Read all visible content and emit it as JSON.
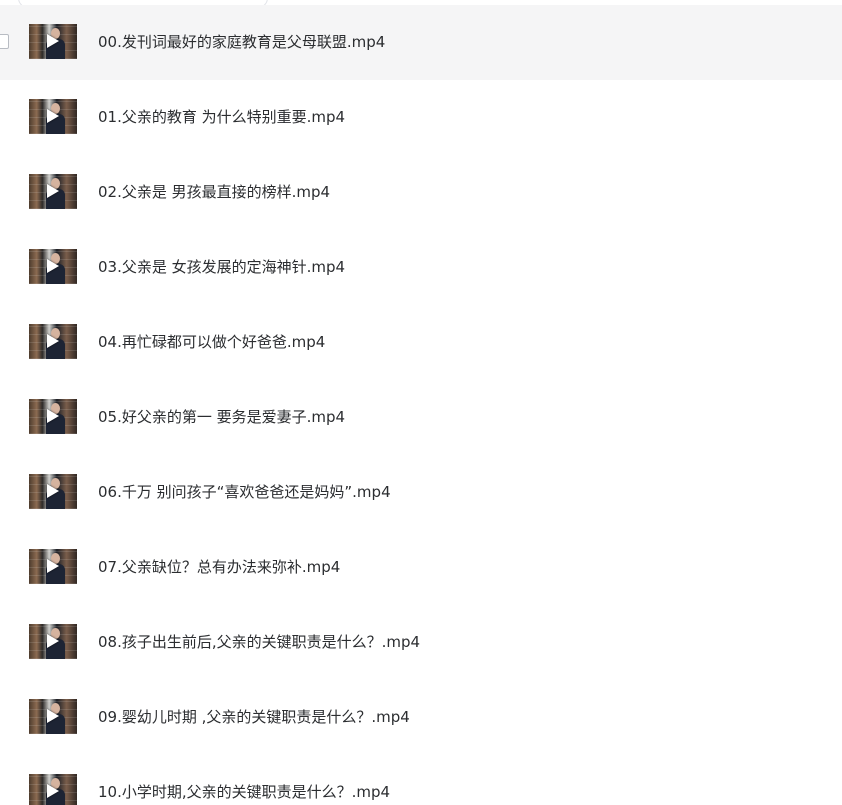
{
  "files": [
    {
      "name": "00.发刊词最好的家庭教育是父母联盟.mp4",
      "selected": true
    },
    {
      "name": "01.父亲的教育 为什么特别重要.mp4",
      "selected": false
    },
    {
      "name": "02.父亲是 男孩最直接的榜样.mp4",
      "selected": false
    },
    {
      "name": "03.父亲是 女孩发展的定海神针.mp4",
      "selected": false
    },
    {
      "name": "04.再忙碌都可以做个好爸爸.mp4",
      "selected": false
    },
    {
      "name": "05.好父亲的第一 要务是爱妻子.mp4",
      "selected": false
    },
    {
      "name": "06.千万 别问孩子“喜欢爸爸还是妈妈”.mp4",
      "selected": false
    },
    {
      "name": "07.父亲缺位？总有办法来弥补.mp4",
      "selected": false
    },
    {
      "name": "08.孩子出生前后,父亲的关键职责是什么？.mp4",
      "selected": false
    },
    {
      "name": "09.婴幼儿时期 ,父亲的关键职责是什么？.mp4",
      "selected": false
    },
    {
      "name": "10.小学时期,父亲的关键职责是什么？.mp4",
      "selected": false
    }
  ],
  "icons": {
    "row_selector": "checkbox-icon",
    "video": "video-thumbnail",
    "play": "play-icon"
  },
  "colors": {
    "selected_row": "#f5f5f6",
    "text": "#2b2d30",
    "checkbox_border": "#b8bcc3"
  }
}
